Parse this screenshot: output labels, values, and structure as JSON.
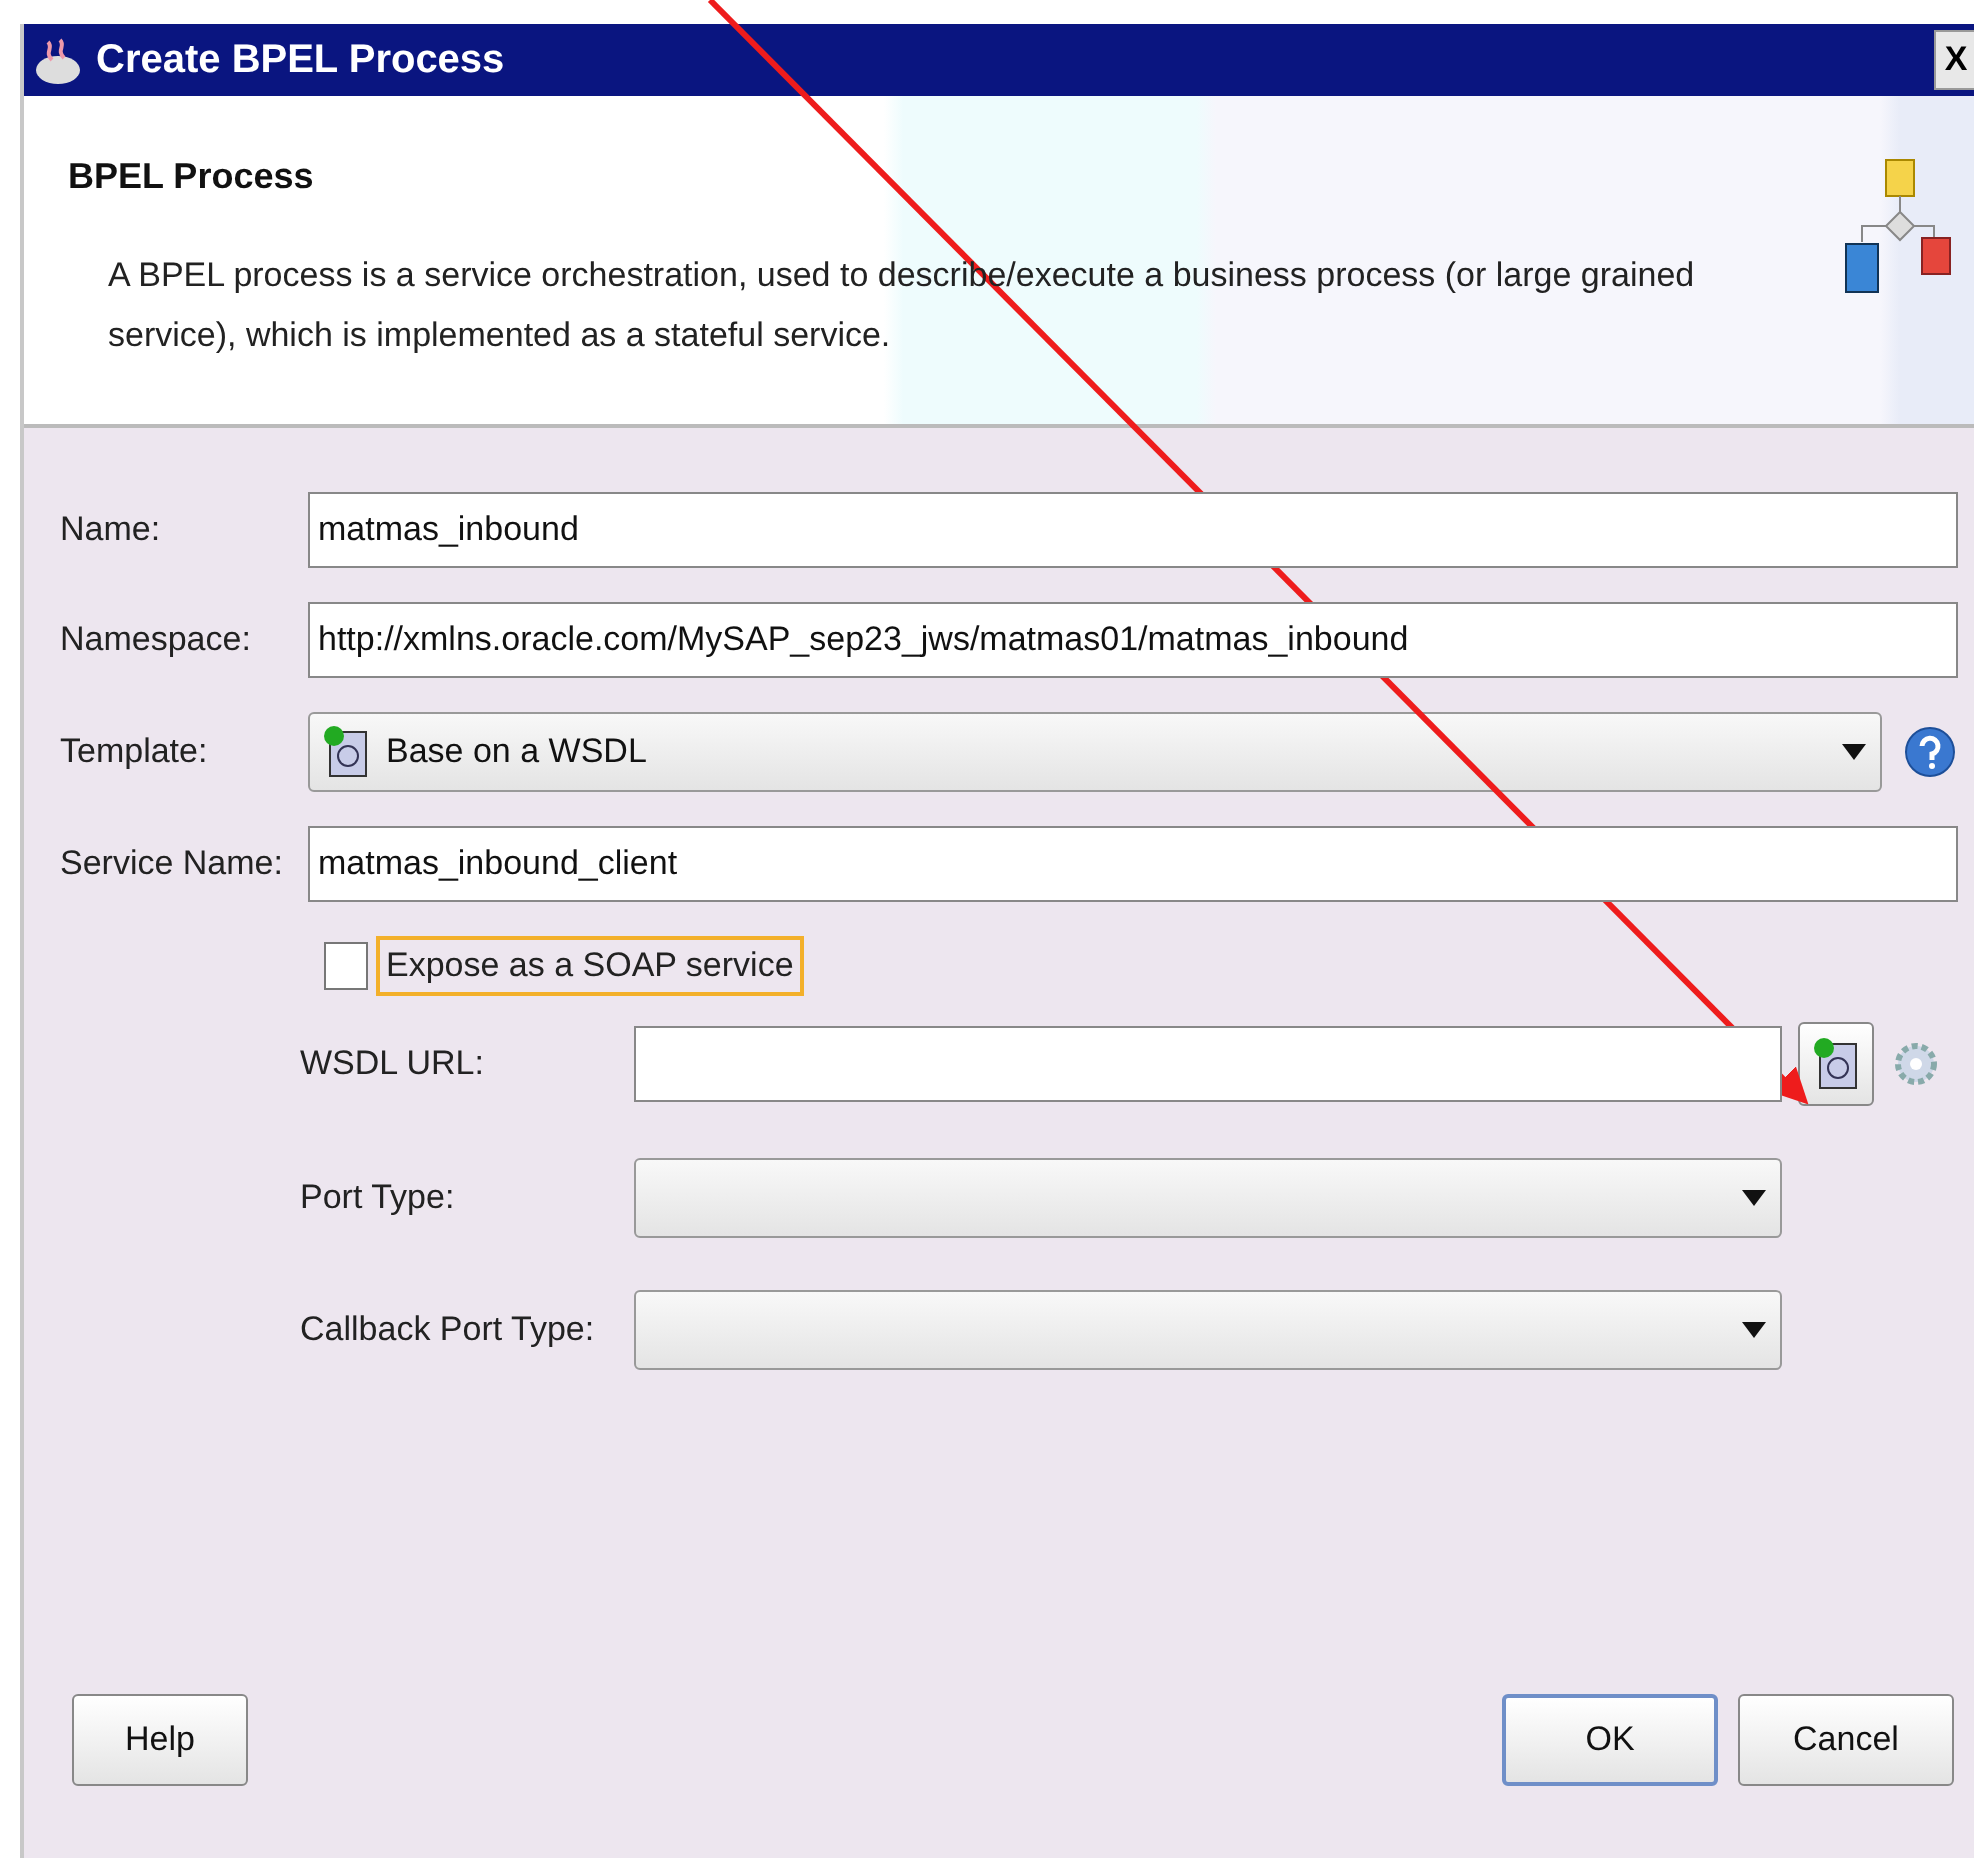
{
  "window": {
    "title": "Create BPEL Process",
    "close": "X"
  },
  "header": {
    "title": "BPEL Process",
    "description": "A BPEL process is a service orchestration, used to describe/execute a business process (or large grained service), which is implemented as a stateful service."
  },
  "fields": [
    {
      "kind": "text",
      "label": "Name:",
      "value": "matmas_inbound"
    },
    {
      "kind": "text",
      "label": "Namespace:",
      "value": "http://xmlns.oracle.com/MySAP_sep23_jws/matmas01/matmas_inbound"
    },
    {
      "kind": "select",
      "label": "Template:",
      "value": "Base on a WSDL",
      "help": true
    },
    {
      "kind": "text",
      "label": "Service Name:",
      "value": "matmas_inbound_client"
    }
  ],
  "expose_soap": {
    "label": "Expose as a SOAP service",
    "checked": false,
    "focused": true
  },
  "wsdl_fields": [
    {
      "kind": "url",
      "label": "WSDL URL:"
    },
    {
      "kind": "select",
      "label": "Port Type:"
    },
    {
      "kind": "select",
      "label": "Callback Port Type:"
    }
  ],
  "buttons": [
    {
      "kind": "help",
      "label": "Help",
      "default": false
    },
    {
      "kind": "ok",
      "label": "OK",
      "default": true
    },
    {
      "kind": "cancel",
      "label": "Cancel",
      "default": false
    }
  ]
}
